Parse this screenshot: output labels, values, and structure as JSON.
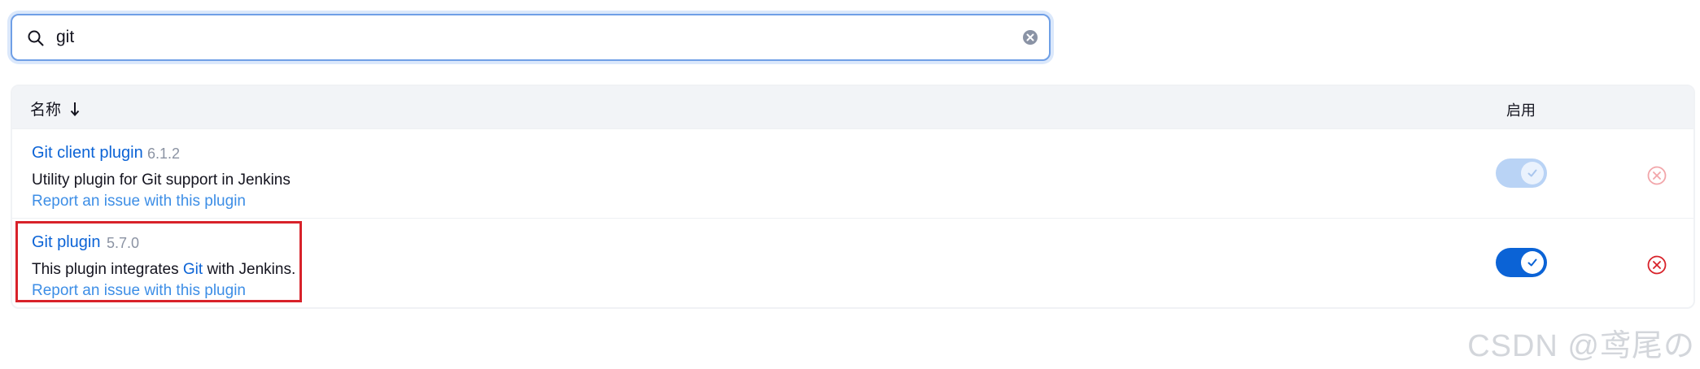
{
  "search": {
    "value": "git",
    "placeholder": ""
  },
  "table": {
    "headers": {
      "name": "名称",
      "name_sort": "↓",
      "enabled": "启用"
    },
    "rows": [
      {
        "name": "Git client plugin",
        "version": "6.1.2",
        "description": "Utility plugin for Git support in Jenkins",
        "report_link": "Report an issue with this plugin",
        "enabled": true,
        "toggle_disabled": true,
        "uninstall_disabled": true
      },
      {
        "name": "Git plugin",
        "version": "5.7.0",
        "description_prefix": "This plugin integrates ",
        "description_link": "Git",
        "description_suffix": " with Jenkins.",
        "report_link": "Report an issue with this plugin",
        "enabled": true,
        "toggle_disabled": false,
        "uninstall_disabled": false,
        "highlighted": true
      }
    ]
  },
  "watermark": "CSDN @鸢尾の",
  "colors": {
    "link": "#0b63d6",
    "toggle_on": "#0b63d6",
    "toggle_disabled": "#b9d3f5",
    "uninstall_active": "#d8222a",
    "uninstall_disabled": "#f2a6aa",
    "highlight": "#d8222a",
    "search_border": "#6f9fe6"
  },
  "icons": {
    "search": "search-icon",
    "clear": "clear-icon",
    "sort": "arrow-down-icon",
    "check": "check-icon",
    "uninstall": "close-circle-icon"
  }
}
